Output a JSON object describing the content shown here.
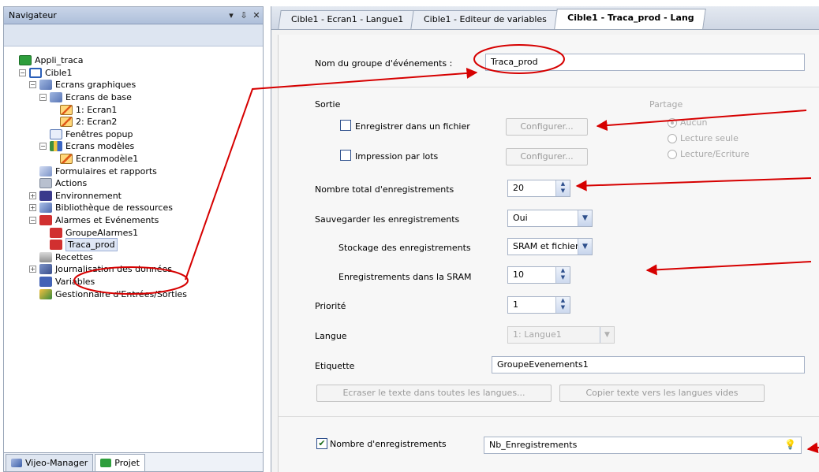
{
  "navigator": {
    "title": "Navigateur",
    "controls": [
      "▾",
      "⇩",
      "✕"
    ],
    "tree": [
      {
        "label": "Appli_traca",
        "indent": 0,
        "exp": "",
        "icon": "app-icon"
      },
      {
        "label": "Cible1",
        "indent": 1,
        "exp": "−",
        "icon": "target-icon"
      },
      {
        "label": "Ecrans graphiques",
        "indent": 2,
        "exp": "−",
        "icon": "folder-icon"
      },
      {
        "label": "Ecrans de base",
        "indent": 3,
        "exp": "−",
        "icon": "folder-icon"
      },
      {
        "label": "1: Ecran1",
        "indent": 4,
        "exp": "",
        "icon": "pencil-icon"
      },
      {
        "label": "2: Ecran2",
        "indent": 4,
        "exp": "",
        "icon": "pencil-icon"
      },
      {
        "label": "Fenêtres popup",
        "indent": 3,
        "exp": "",
        "icon": "popup-icon"
      },
      {
        "label": "Ecrans modèles",
        "indent": 3,
        "exp": "−",
        "icon": "template-icon"
      },
      {
        "label": "Ecranmodèle1",
        "indent": 4,
        "exp": "",
        "icon": "pencil-icon"
      },
      {
        "label": "Formulaires et rapports",
        "indent": 2,
        "exp": "",
        "icon": "forms-icon"
      },
      {
        "label": "Actions",
        "indent": 2,
        "exp": "",
        "icon": "actions-icon"
      },
      {
        "label": "Environnement",
        "indent": 2,
        "exp": "+",
        "icon": "environment-icon"
      },
      {
        "label": "Bibliothèque de ressources",
        "indent": 2,
        "exp": "+",
        "icon": "library-icon"
      },
      {
        "label": "Alarmes et Evénements",
        "indent": 2,
        "exp": "−",
        "icon": "alarm-icon"
      },
      {
        "label": "GroupeAlarmes1",
        "indent": 3,
        "exp": "",
        "icon": "alarm-icon"
      },
      {
        "label": "Traca_prod",
        "indent": 3,
        "exp": "",
        "icon": "alarm-icon",
        "selected": true
      },
      {
        "label": "Recettes",
        "indent": 2,
        "exp": "",
        "icon": "recipe-icon"
      },
      {
        "label": "Journalisation des données",
        "indent": 2,
        "exp": "+",
        "icon": "log-icon"
      },
      {
        "label": "Variables",
        "indent": 2,
        "exp": "",
        "icon": "variables-icon"
      },
      {
        "label": "Gestionnaire d'Entrées/Sorties",
        "indent": 2,
        "exp": "",
        "icon": "io-icon"
      }
    ],
    "bottom_tabs": [
      "Vijeo-Manager",
      "Projet"
    ]
  },
  "editor": {
    "tabs": [
      "Cible1 - Ecran1 - Langue1",
      "Cible1 - Editeur de variables",
      "Cible1 - Traca_prod - Lang"
    ],
    "group_name_label": "Nom du groupe d'événements :",
    "group_name_value": "Traca_prod",
    "output_label": "Sortie",
    "save_file_label": "Enregistrer dans un fichier",
    "configure_label_1": "Configurer...",
    "batch_print_label": "Impression par lots",
    "configure_label_2": "Configurer...",
    "share_label": "Partage",
    "share_options": [
      "Aucun",
      "Lecture seule",
      "Lecture/Ecriture"
    ],
    "total_records_label": "Nombre total d'enregistrements",
    "total_records_value": "20",
    "save_records_label": "Sauvegarder les enregistrements",
    "save_records_value": "Oui",
    "storage_label": "Stockage des enregistrements",
    "storage_value": "SRAM et fichier",
    "sram_records_label": "Enregistrements dans la SRAM",
    "sram_records_value": "10",
    "priority_label": "Priorité",
    "priority_value": "1",
    "language_label": "Langue",
    "language_value": "1: Langue1",
    "tag_label": "Etiquette",
    "tag_value": "GroupeEvenements1",
    "overwrite_button": "Ecraser le texte dans toutes les langues...",
    "copy_button": "Copier texte vers les langues vides",
    "record_count_label": "Nombre d'enregistrements",
    "record_count_value": "Nb_Enregistrements"
  },
  "colors": {
    "annotation": "#d60000",
    "arrow": "#d60000"
  }
}
